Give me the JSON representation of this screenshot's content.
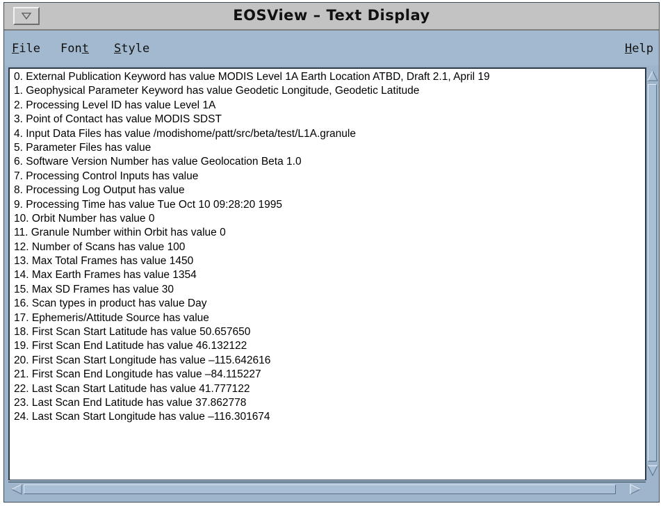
{
  "window": {
    "title": "EOSView – Text Display"
  },
  "menubar": {
    "file": {
      "mnemonic": "F",
      "rest": "ile"
    },
    "font": {
      "prefix": "Fon",
      "mnemonic": "t"
    },
    "style": {
      "mnemonic": "S",
      "rest": "tyle"
    },
    "help": {
      "mnemonic": "H",
      "rest": "elp"
    }
  },
  "lines": [
    "0. External Publication Keyword has value MODIS Level 1A Earth Location ATBD, Draft 2.1, April 19",
    "1. Geophysical Parameter Keyword has value Geodetic Longitude, Geodetic Latitude",
    "2. Processing Level ID has value Level 1A",
    "3. Point of Contact has value MODIS SDST",
    "4. Input Data Files has value /modishome/patt/src/beta/test/L1A.granule",
    "5. Parameter Files has value",
    "6. Software Version Number has value Geolocation Beta 1.0",
    "7. Processing Control Inputs has value",
    "8. Processing Log Output has value",
    "9. Processing Time has value Tue Oct 10 09:28:20 1995",
    "10. Orbit Number has value 0",
    "11. Granule Number within Orbit has value 0",
    "12. Number of Scans has value 100",
    "13. Max Total Frames has value 1450",
    "14. Max Earth Frames has value 1354",
    "15. Max SD Frames has value 30",
    "16. Scan types in product has value Day",
    "17. Ephemeris/Attitude Source has value",
    "18. First Scan Start Latitude has value 50.657650",
    "19. First Scan End Latitude has value 46.132122",
    "20. First Scan Start Longitude has value –115.642616",
    "21. First Scan End Longitude has value –84.115227",
    "22. Last Scan Start Latitude has value 41.777122",
    "23. Last Scan End Latitude has value 37.862778",
    "24. Last Scan Start Longitude has value –116.301674"
  ],
  "icons": {
    "window_menu": "window-menu-icon",
    "scroll_up": "scroll-up-arrow-icon",
    "scroll_down": "scroll-down-arrow-icon",
    "scroll_left": "scroll-left-arrow-icon",
    "scroll_right": "scroll-right-arrow-icon"
  },
  "colors": {
    "chrome": "#9fb5cc",
    "titlebar": "#c3c3c3",
    "text_bg": "#ffffff"
  }
}
